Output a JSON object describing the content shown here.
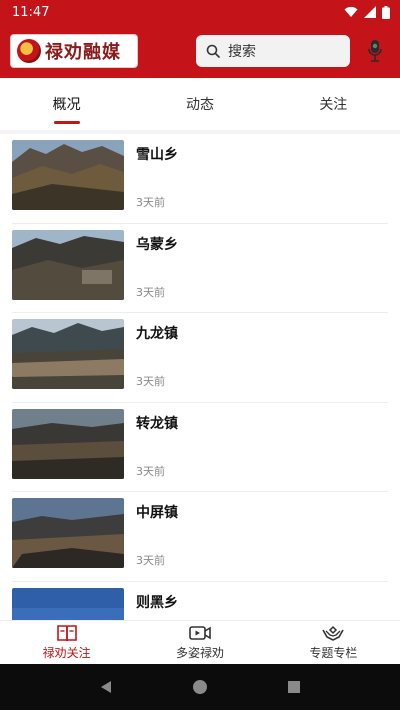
{
  "status_bar": {
    "time": "11:47"
  },
  "header": {
    "logo_text": "禄劝融媒",
    "search_placeholder": "搜索"
  },
  "tabs": [
    {
      "label": "概况",
      "active": true
    },
    {
      "label": "动态",
      "active": false
    },
    {
      "label": "关注",
      "active": false
    }
  ],
  "items": [
    {
      "title": "雪山乡",
      "time": "3天前"
    },
    {
      "title": "乌蒙乡",
      "time": "3天前"
    },
    {
      "title": "九龙镇",
      "time": "3天前"
    },
    {
      "title": "转龙镇",
      "time": "3天前"
    },
    {
      "title": "中屏镇",
      "time": "3天前"
    },
    {
      "title": "则黑乡",
      "time": ""
    }
  ],
  "bottom_nav": [
    {
      "label": "禄劝关注",
      "icon": "book-icon",
      "active": true
    },
    {
      "label": "多姿禄劝",
      "icon": "video-icon",
      "active": false
    },
    {
      "label": "专题专栏",
      "icon": "hands-icon",
      "active": false
    }
  ],
  "colors": {
    "brand_red": "#c4141a"
  }
}
